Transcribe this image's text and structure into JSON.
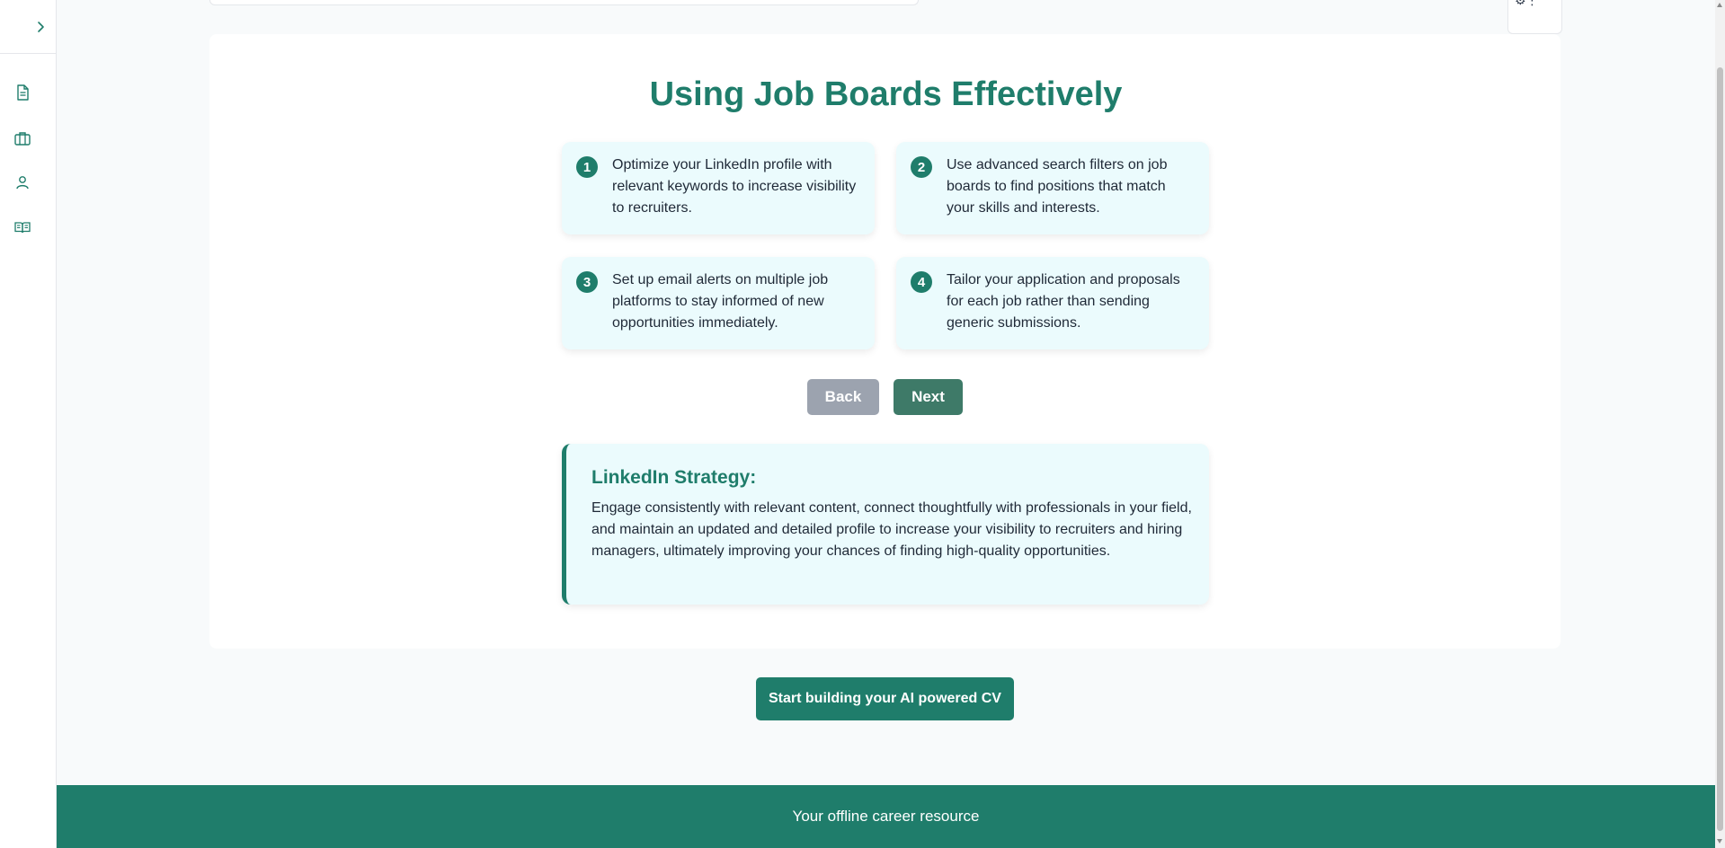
{
  "sidebar": {
    "toggle_icon": "chevron-right-icon",
    "items": [
      {
        "icon": "document-icon"
      },
      {
        "icon": "briefcase-icon"
      },
      {
        "icon": "user-icon"
      },
      {
        "icon": "book-open-icon"
      }
    ],
    "accent": "#1f7d6b"
  },
  "main": {
    "title": "Using Job Boards Effectively",
    "tips": [
      {
        "number": "1",
        "text": "Optimize your LinkedIn profile with relevant keywords to increase visibility to recruiters."
      },
      {
        "number": "2",
        "text": "Use advanced search filters on job boards to find positions that match your skills and interests."
      },
      {
        "number": "3",
        "text": "Set up email alerts on multiple job platforms to stay informed of new opportunities immediately."
      },
      {
        "number": "4",
        "text": "Tailor your application and proposals for each job rather than sending generic submissions."
      }
    ],
    "nav": {
      "back_label": "Back",
      "next_label": "Next"
    },
    "strategy": {
      "title": "LinkedIn Strategy:",
      "text": "Engage consistently with relevant content, connect thoughtfully with professionals in your field, and maintain an updated and detailed profile to increase your visibility to recruiters and hiring managers, ultimately improving your chances of finding high-quality opportunities."
    }
  },
  "cta": {
    "label": "Start building your AI powered CV"
  },
  "footer": {
    "text": "Your offline career resource"
  },
  "colors": {
    "brand": "#1f7d6b",
    "tip_bg": "#ebfbfd",
    "back_button": "#9ca3af",
    "next_button": "#3e7a68"
  }
}
